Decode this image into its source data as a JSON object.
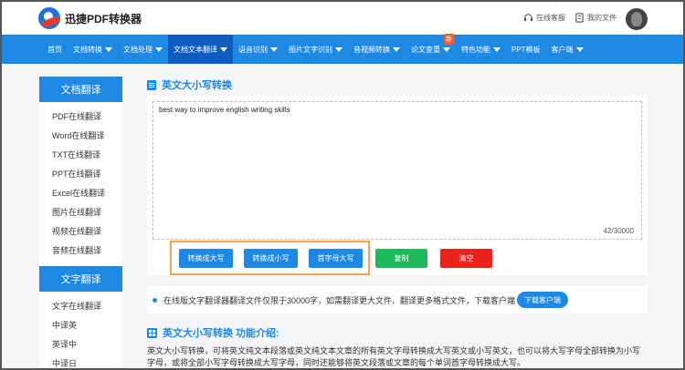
{
  "header": {
    "brand": "迅捷PDF转换器",
    "service_link": "在线客服",
    "files_link": "我的文件"
  },
  "nav": {
    "items": [
      {
        "label": "首页",
        "caret": false
      },
      {
        "label": "文档转换",
        "caret": true
      },
      {
        "label": "文档处理",
        "caret": true
      },
      {
        "label": "文档文本翻译",
        "caret": true,
        "active": true
      },
      {
        "label": "语音识别",
        "caret": true
      },
      {
        "label": "图片文字识别",
        "caret": true
      },
      {
        "label": "音视频转换",
        "caret": true
      },
      {
        "label": "论文查重",
        "caret": true,
        "badge": "新"
      },
      {
        "label": "特色功能",
        "caret": true
      },
      {
        "label": "PPT模板",
        "caret": false
      },
      {
        "label": "客户端",
        "caret": true
      }
    ]
  },
  "sidebar": {
    "section1_title": "文档翻译",
    "section1_items": [
      "PDF在线翻译",
      "Word在线翻译",
      "TXT在线翻译",
      "PPT在线翻译",
      "Excel在线翻译",
      "图片在线翻译",
      "视频在线翻译",
      "音频在线翻译"
    ],
    "section2_title": "文字翻译",
    "section2_items": [
      "文字在线翻译",
      "中译英",
      "英译中",
      "中译日"
    ]
  },
  "main": {
    "title": "英文大小写转换",
    "input_text": "best way to improve english writing skills",
    "counter": "42/30000",
    "buttons": {
      "upper": "转换成大写",
      "lower": "转换成小写",
      "capitalize": "首字母大写",
      "copy": "复制",
      "clear": "清空"
    },
    "info_text": "在线版文字翻译器翻译文件仅限于30000字，如需翻译更大文件、翻译更多格式文件，下载客户端",
    "download_button": "下载客户端",
    "intro_title": "英文大小写转换 功能介绍:",
    "intro_text": "英文大小写转换，可将英文纯文本段落或英文纯文本文章的所有英文字母转换成大写英文或小写英文，也可以将大写字母全部转换为小写字母，或将全部小写字母转换成大写字母，同时还能够将英文段落或文章的每个单词首字母转换成大写。"
  },
  "colors": {
    "accent": "#1e88e5",
    "nav_active": "#0d5cbf",
    "copy_button": "#1fba5a",
    "clear_button": "#e8241c",
    "highlight_border": "#f5a455"
  }
}
